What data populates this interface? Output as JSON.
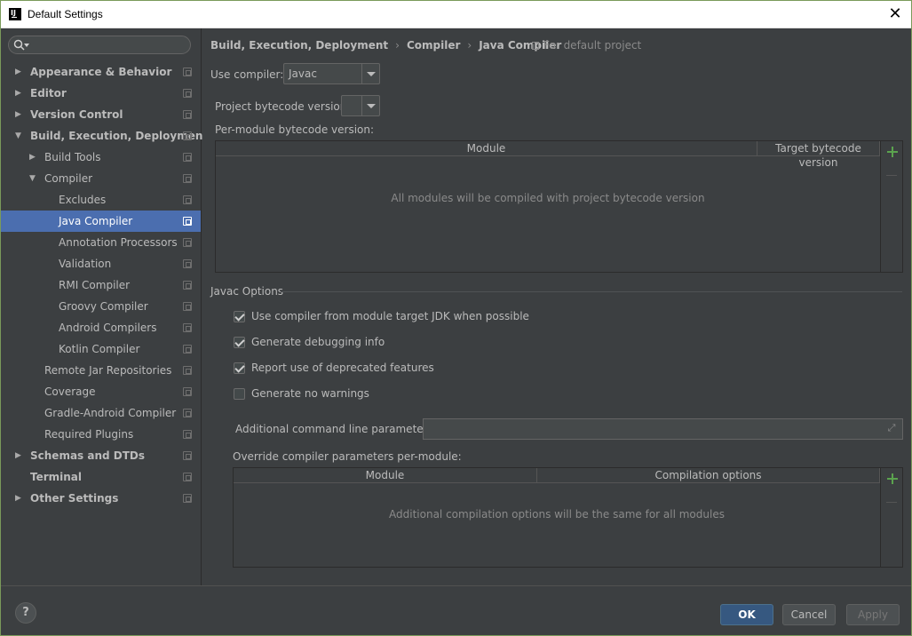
{
  "window": {
    "title": "Default Settings"
  },
  "search": {
    "placeholder": ""
  },
  "sidebar": {
    "items": [
      {
        "label": "Appearance & Behavior",
        "bold": true,
        "arrow": "right",
        "indent": 0
      },
      {
        "label": "Editor",
        "bold": true,
        "arrow": "right",
        "indent": 0
      },
      {
        "label": "Version Control",
        "bold": true,
        "arrow": "right",
        "indent": 0
      },
      {
        "label": "Build, Execution, Deployment",
        "bold": true,
        "arrow": "down",
        "indent": 0
      },
      {
        "label": "Build Tools",
        "bold": false,
        "arrow": "right",
        "indent": 1
      },
      {
        "label": "Compiler",
        "bold": false,
        "arrow": "down",
        "indent": 1
      },
      {
        "label": "Excludes",
        "bold": false,
        "arrow": "",
        "indent": 2
      },
      {
        "label": "Java Compiler",
        "bold": false,
        "arrow": "",
        "indent": 2,
        "selected": true
      },
      {
        "label": "Annotation Processors",
        "bold": false,
        "arrow": "",
        "indent": 2
      },
      {
        "label": "Validation",
        "bold": false,
        "arrow": "",
        "indent": 2
      },
      {
        "label": "RMI Compiler",
        "bold": false,
        "arrow": "",
        "indent": 2
      },
      {
        "label": "Groovy Compiler",
        "bold": false,
        "arrow": "",
        "indent": 2
      },
      {
        "label": "Android Compilers",
        "bold": false,
        "arrow": "",
        "indent": 2
      },
      {
        "label": "Kotlin Compiler",
        "bold": false,
        "arrow": "",
        "indent": 2
      },
      {
        "label": "Remote Jar Repositories",
        "bold": false,
        "arrow": "",
        "indent": 1
      },
      {
        "label": "Coverage",
        "bold": false,
        "arrow": "",
        "indent": 1
      },
      {
        "label": "Gradle-Android Compiler",
        "bold": false,
        "arrow": "",
        "indent": 1
      },
      {
        "label": "Required Plugins",
        "bold": false,
        "arrow": "",
        "indent": 1
      },
      {
        "label": "Schemas and DTDs",
        "bold": true,
        "arrow": "right",
        "indent": 0
      },
      {
        "label": "Terminal",
        "bold": true,
        "arrow": "",
        "indent": 0
      },
      {
        "label": "Other Settings",
        "bold": true,
        "arrow": "right",
        "indent": 0
      }
    ]
  },
  "breadcrumb": {
    "parts": [
      "Build, Execution, Deployment",
      "Compiler",
      "Java Compiler"
    ],
    "separator": "›",
    "note": "For default project"
  },
  "compiler": {
    "use_label": "Use compiler:",
    "use_value": "Javac",
    "bytecode_label": "Project bytecode version:",
    "bytecode_value": "",
    "per_module_label": "Per-module bytecode version:"
  },
  "module_table": {
    "col_module": "Module",
    "col_target": "Target bytecode version",
    "empty_text": "All modules will be compiled with project bytecode version"
  },
  "javac": {
    "section_title": "Javac Options",
    "options": [
      {
        "label": "Use compiler from module target JDK when possible",
        "checked": true
      },
      {
        "label": "Generate debugging info",
        "checked": true
      },
      {
        "label": "Report use of deprecated features",
        "checked": true
      },
      {
        "label": "Generate no warnings",
        "checked": false
      }
    ],
    "cmd_label": "Additional command line parameters:",
    "cmd_value": "",
    "override_label": "Override compiler parameters per-module:"
  },
  "override_table": {
    "col_module": "Module",
    "col_options": "Compilation options",
    "empty_text": "Additional compilation options will be the same for all modules"
  },
  "footer": {
    "help": "?",
    "ok": "OK",
    "cancel": "Cancel",
    "apply": "Apply"
  },
  "colors": {
    "background": "#3c3f41",
    "selection": "#4b6eaf",
    "ok_button": "#365880",
    "add_icon": "#5ba34e"
  }
}
